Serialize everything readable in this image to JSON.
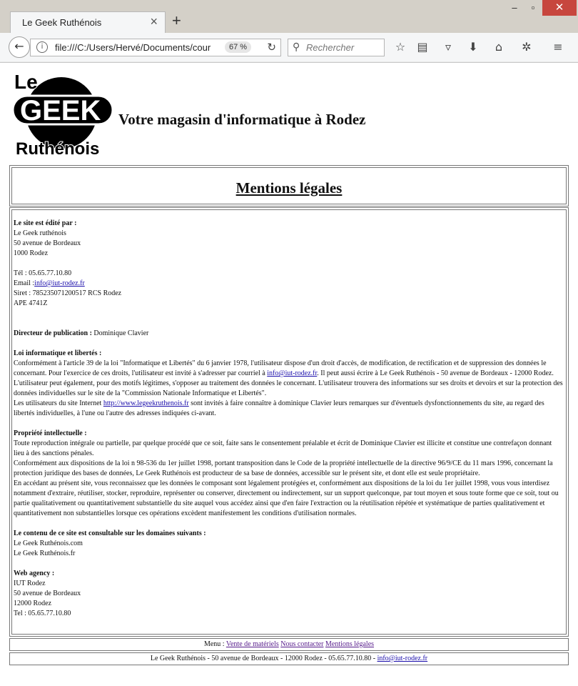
{
  "browser": {
    "tab_title": "Le Geek Ruthénois",
    "url": "file:///C:/Users/Hervé/Documents/cours",
    "zoom": "67 %",
    "search_placeholder": "Rechercher"
  },
  "header": {
    "logo": {
      "line1": "Le",
      "line2": "GEEK",
      "line3": "Ruthénois"
    },
    "headline": "Votre magasin d'informatique à Rodez"
  },
  "page_title": "Mentions légales",
  "editor": {
    "heading": "Le site est édité par :",
    "name": "Le Geek ruthénois",
    "street": "50 avenue de Bordeaux",
    "city": "1000 Rodez",
    "tel": "Tél : 05.65.77.10.80",
    "email_label": "Email :",
    "email": "info@iut-rodez.fr",
    "siret": "Siret : 785235071200517 RCS Rodez",
    "ape": "APE 4741Z"
  },
  "director": {
    "heading": "Directeur de publication :",
    "name": " Dominique Clavier"
  },
  "cnil": {
    "heading": "Loi informatique et libertés :",
    "p1a": "Conformément à l'article 39 de la loi \"Informatique et Libertés\" du 6 janvier 1978, l'utilisateur dispose d'un droit d'accès, de modification, de rectification et de suppression des données le concernant. Pour l'exercice de ces droits, l'utilisateur est invité à s'adresser par courriel à ",
    "p1_link": "info@iut-rodez.fr",
    "p1b": ". Il peut aussi écrire à Le Geek Ruthénois - 50 avenue de Bordeaux - 12000 Rodez.",
    "p2": "L'utilisateur peut également, pour des motifs légitimes, s'opposer au traitement des données le concernant. L'utilisateur trouvera des informations sur ses droits et devoirs et sur la protection des données individuelles sur le site de la \"Commission Nationale Informatique et Libertés\".",
    "p3a": "Les utilisateurs du site Internet ",
    "p3_link": "http://www.legeekruthenois.fr",
    "p3b": " sont invités à faire connaître à dominique Clavier leurs remarques sur d'éventuels dysfonctionnements du site, au regard des libertés individuelles, à l'une ou l'autre des adresses indiquées ci-avant."
  },
  "ip": {
    "heading": "Propriété intellectuelle :",
    "p1": "Toute reproduction intégrale ou partielle, par quelque procédé que ce soit, faite sans le consentement préalable et écrit de Dominique Clavier est illicite et constitue une contrefaçon donnant lieu à des sanctions pénales.",
    "p2": "Conformément aux dispositions de la loi n 98-536 du 1er juillet 1998, portant transposition dans le Code de la propriété intellectuelle de la directive 96/9/CE du 11 mars 1996, concernant la protection juridique des bases de données, Le Geek Ruthénois est producteur de sa base de données, accessible sur le présent site, et dont elle est seule propriétaire.",
    "p3": "En accédant au présent site, vous reconnaissez que les données le composant sont légalement protégées et, conformément aux dispositions de la loi du 1er juillet 1998, vous vous interdisez notamment d'extraire, réutiliser, stocker, reproduire, représenter ou conserver, directement ou indirectement, sur un support quelconque, par tout moyen et sous toute forme que ce soit, tout ou partie qualitativement ou quantitativement substantielle du site auquel vous accédez ainsi que d'en faire l'extraction ou la réutilisation répétée et systématique de parties qualitativement et quantitativement non substantielles lorsque ces opérations excèdent manifestement les conditions d'utilisation normales."
  },
  "domains": {
    "heading": "Le contenu de ce site est consultable sur les domaines suivants :",
    "d1": "Le Geek Ruthénois.com",
    "d2": "Le Geek Ruthénois.fr"
  },
  "agency": {
    "heading": "Web agency :",
    "name": "IUT Rodez",
    "street": "50 avenue de Bordeaux",
    "city": "12000 Rodez",
    "tel": "Tel : 05.65.77.10.80"
  },
  "menu": {
    "label": "Menu : ",
    "items": [
      "Vente de matériels",
      "Nous contacter",
      "Mentions légales"
    ]
  },
  "footer": {
    "text": "Le Geek Ruthénois - 50 avenue de Bordeaux - 12000 Rodez - 05.65.77.10.80 - ",
    "email": "info@iut-rodez.fr"
  }
}
